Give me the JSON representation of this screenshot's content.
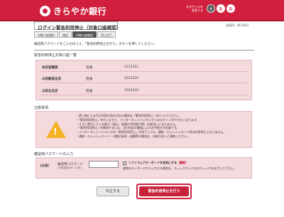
{
  "header": {
    "logo_text": "きらやか銀行",
    "fontsize_label": "文字サイズを変更する",
    "fontsize_buttons": [
      "大",
      "あ",
      "あ"
    ]
  },
  "screen_id": "画面ID：BCS003",
  "page_title": "ログイン緊急利用停止（対象口座確認）",
  "steps": [
    "対象口座選択",
    "確認",
    "対象口座確認",
    "停止完了"
  ],
  "intro": "確認用パスワードをご入力のうえ、「緊急利用停止を行う」ボタンを押してください。",
  "accounts_section": {
    "label": "緊急利用停止対象口座一覧",
    "rows": [
      {
        "branch": "本店営業部",
        "type": "普通",
        "number": "1111111"
      },
      {
        "branch": "山形駅前支店",
        "type": "普通",
        "number": "2222222"
      },
      {
        "branch": "山形北支店",
        "type": "普通",
        "number": "3333333"
      }
    ]
  },
  "notes_section": {
    "label": "注意事項",
    "items": [
      "第三者による不正利用の恐れがある場合は「緊急利用停止」を行ってください。",
      "「緊急利用停止」を行いますと、インターネットバンキングへのログインができなくなります。",
      "すでに受付している取引（振込・振替の予約取引等）は取消しになりません。",
      "「緊急利用停止」を解除するには、当行所定の書面によるお手続きが必要です。",
      "インターネットバンキングの「緊急利用停止」が完了しても、通帳・キャッシュカード等は利用停止となりません。",
      "通帳・キャッシュカード・印鑑の紛失・盗難等の場合は、お取引店へご連絡ください。"
    ]
  },
  "password_section": {
    "label": "確認用パスワードの入力",
    "required": "[必須]",
    "field_label": "確認用パスワード",
    "field_sub": "(半角英数字6～12桁)",
    "input_value": "",
    "keyboard_check": "✓",
    "keyboard_label_prefix": "ソフトウェアキーボードを有効にする",
    "keyboard_link": "（解説）",
    "keyboard_note": "通常のキーボードから入力する場合は、チェックボックスのチェックをはずして下さい。"
  },
  "buttons": {
    "cancel": "中止する",
    "submit": "緊急利用停止を行う"
  }
}
